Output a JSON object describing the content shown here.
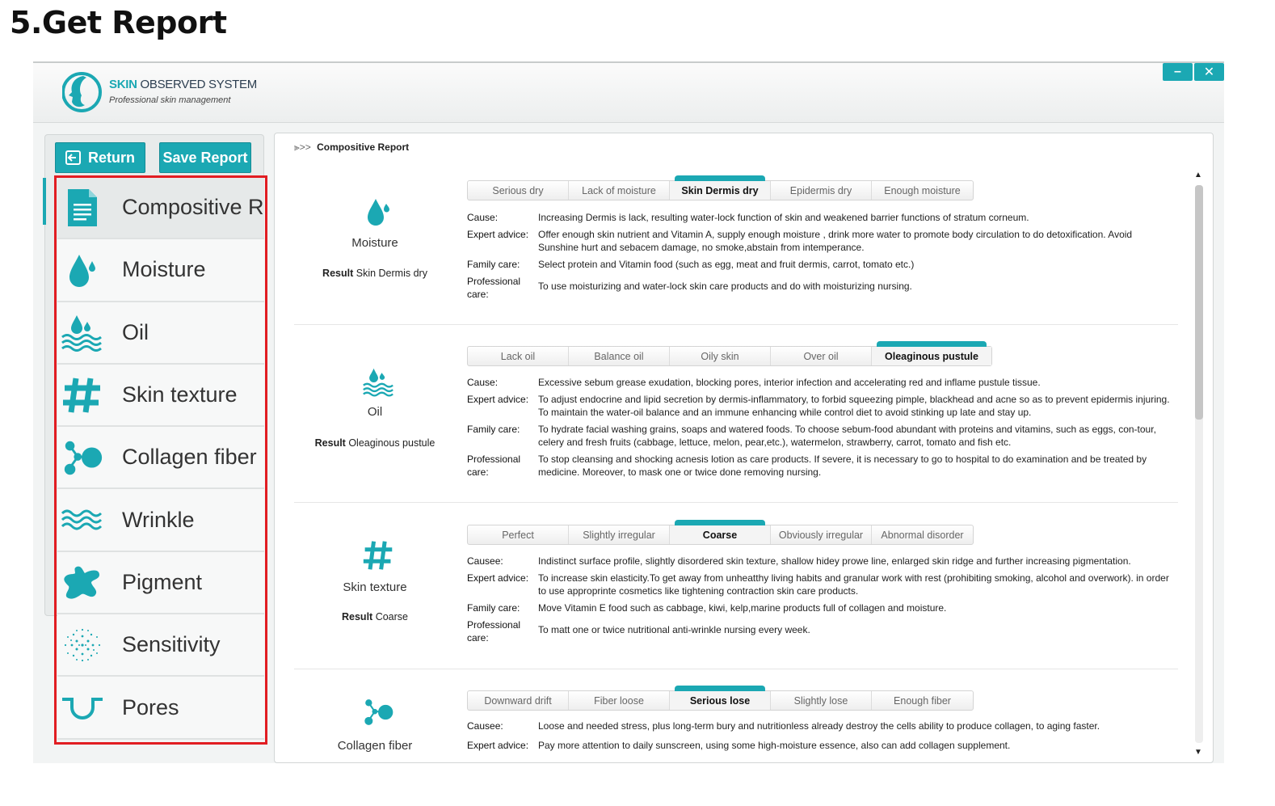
{
  "page_heading": "5.Get Report",
  "app": {
    "name_prefix": "SKIN",
    "name_rest": " OBSERVED SYSTEM",
    "subtitle": "Professional skin management",
    "minimize": "–",
    "close": "✕"
  },
  "toolbar": {
    "return_label": "Return",
    "save_label": "Save Report"
  },
  "nav": [
    {
      "label": "Compositive R",
      "icon": "document-icon"
    },
    {
      "label": "Moisture",
      "icon": "water-drop-icon"
    },
    {
      "label": "Oil",
      "icon": "oil-icon"
    },
    {
      "label": "Skin texture",
      "icon": "hash-icon"
    },
    {
      "label": "Collagen fiber",
      "icon": "molecule-icon"
    },
    {
      "label": "Wrinkle",
      "icon": "wave-icon"
    },
    {
      "label": "Pigment",
      "icon": "splash-icon"
    },
    {
      "label": "Sensitivity",
      "icon": "dots-icon"
    },
    {
      "label": "Pores",
      "icon": "pore-icon"
    }
  ],
  "report": {
    "crumb": "⫸>>",
    "title": "Compositive Report",
    "sections": [
      {
        "name": "Moisture",
        "result_label": "Result",
        "result_value": "Skin Dermis dry",
        "levels": [
          "Serious dry",
          "Lack of moisture",
          "Skin Dermis dry",
          "Epidermis dry",
          "Enough moisture"
        ],
        "selected_level": "Skin Dermis dry",
        "rows": [
          {
            "label": "Cause:",
            "text": "Increasing Dermis is lack, resulting water-lock function of skin and weakened barrier functions of stratum corneum."
          },
          {
            "label": "Expert advice:",
            "text": "Offer enough skin nutrient and Vitamin A, supply enough moisture , drink more water to promote body circulation to do detoxification. Avoid Sunshine hurt and sebacem damage, no smoke,abstain from intemperance."
          },
          {
            "label": "Family care:",
            "text": "Select protein and Vitamin food (such as egg, meat and fruit dermis, carrot, tomato etc.)"
          },
          {
            "label": "Professional care:",
            "text": "To use moisturizing and water-lock skin care products and do with moisturizing nursing."
          }
        ]
      },
      {
        "name": "Oil",
        "result_label": "Result",
        "result_value": "Oleaginous pustule",
        "levels": [
          "Lack oil",
          "Balance oil",
          "Oily skin",
          "Over oil",
          "Oleaginous pustule"
        ],
        "selected_level": "Oleaginous pustule",
        "rows": [
          {
            "label": "Cause:",
            "text": "Excessive sebum grease exudation, blocking pores, interior infection and accelerating red and inflame pustule tissue."
          },
          {
            "label": "Expert advice:",
            "text": "To adjust endocrine and lipid secretion by dermis-inflammatory, to forbid squeezing pimple, blackhead and acne so as to prevent epidermis injuring. To maintain the water-oil balance and an immune enhancing while control diet to avoid stinking up late and stay up."
          },
          {
            "label": "Family care:",
            "text": "To hydrate facial washing grains, soaps and watered foods. To choose sebum-food abundant with proteins and vitamins, such as eggs, con-tour, celery and fresh fruits (cabbage, lettuce, melon, pear,etc.), watermelon, strawberry, carrot, tomato and fish etc."
          },
          {
            "label": "Professional care:",
            "text": "To stop cleansing and shocking acnesis lotion as care products. If severe, it is necessary to go to hospital to do examination and be treated by medicine. Moreover, to mask one or twice done removing nursing."
          }
        ]
      },
      {
        "name": "Skin texture",
        "result_label": "Result",
        "result_value": "Coarse",
        "levels": [
          "Perfect",
          "Slightly irregular",
          "Coarse",
          "Obviously irregular",
          "Abnormal disorder"
        ],
        "selected_level": "Coarse",
        "rows": [
          {
            "label": "Causee:",
            "text": "Indistinct surface profile, slightly disordered skin texture, shallow hidey prowe line, enlarged skin ridge and further increasing pigmentation."
          },
          {
            "label": "Expert advice:",
            "text": "To increase skin elasticity.To get away from unheatthy living habits and granular work with rest (prohibiting smoking, alcohol and overwork). in order to use approprinte cosmetics like tightening contraction skin care products."
          },
          {
            "label": "Family care:",
            "text": "Move Vitamin E food such as cabbage, kiwi, kelp,marine products full of collagen and moisture."
          },
          {
            "label": "Professional care:",
            "text": "To matt one or twice nutritional anti-wrinkle nursing every week."
          }
        ]
      },
      {
        "name": "Collagen fiber",
        "result_label": "",
        "result_value": "",
        "levels": [
          "Downward drift",
          "Fiber loose",
          "Serious lose",
          "Slightly lose",
          "Enough fiber"
        ],
        "selected_level": "Serious lose",
        "rows": [
          {
            "label": "Causee:",
            "text": "Loose and needed stress, plus long-term bury and nutritionless already destroy the cells ability to produce collagen, to aging faster."
          },
          {
            "label": "Expert advice:",
            "text": "Pay more attention to daily sunscreen, using some high-moisture essence, also can add collagen supplement."
          }
        ]
      }
    ]
  },
  "colors": {
    "accent": "#1ba8b3",
    "highlight_box": "#e11d22"
  }
}
